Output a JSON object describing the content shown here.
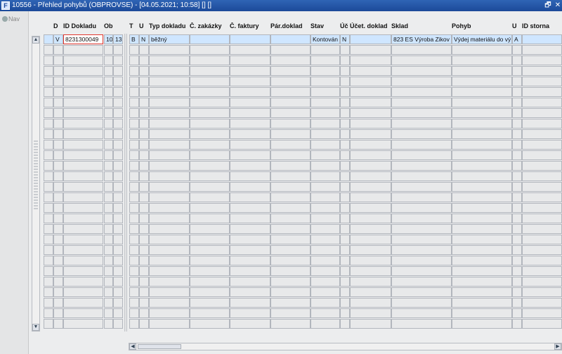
{
  "window": {
    "app_icon_text": "F",
    "title": "10556 - Přehled pohybů (OBPROVSE) - [04.05.2021; 10:58] [] []",
    "restore_glyph": "🗗",
    "close_glyph": "✕"
  },
  "nav": {
    "label": "Nav"
  },
  "columns": [
    {
      "key": "d",
      "label": "D"
    },
    {
      "key": "id_dokladu",
      "label": "ID Dokladu"
    },
    {
      "key": "ob",
      "label": "Ob"
    },
    {
      "key": "t",
      "label": "T"
    },
    {
      "key": "u",
      "label": "U"
    },
    {
      "key": "typ_dokladu",
      "label": "Typ dokladu"
    },
    {
      "key": "c_zakazky",
      "label": "Č. zakázky"
    },
    {
      "key": "c_faktury",
      "label": "Č. faktury"
    },
    {
      "key": "par_doklad",
      "label": "Pár.doklad"
    },
    {
      "key": "stav",
      "label": "Stav"
    },
    {
      "key": "uc",
      "label": "Úč"
    },
    {
      "key": "ucet_doklad",
      "label": "Účet. doklad"
    },
    {
      "key": "sklad",
      "label": "Sklad"
    },
    {
      "key": "pohyb",
      "label": "Pohyb"
    },
    {
      "key": "u2",
      "label": "U"
    },
    {
      "key": "id_storna",
      "label": "ID storna"
    }
  ],
  "rows": [
    {
      "marker": "",
      "d": "V",
      "id_dokladu": "8231300049",
      "ob": "10",
      "ob2": "13",
      "t": "B",
      "u": "N",
      "typ_dokladu": "běžný",
      "c_zakazky": "",
      "c_faktury": "",
      "par_doklad": "",
      "stav": "Kontován",
      "uc": "N",
      "ucet_doklad": "",
      "sklad": "823 ES Výroba Zikov",
      "pohyb": "Výdej materiálu do vý",
      "u2": "A",
      "id_storna": ""
    }
  ],
  "empty_rows": 27,
  "scroll": {
    "up": "▲",
    "down": "▼",
    "left": "◀",
    "right": "▶"
  }
}
